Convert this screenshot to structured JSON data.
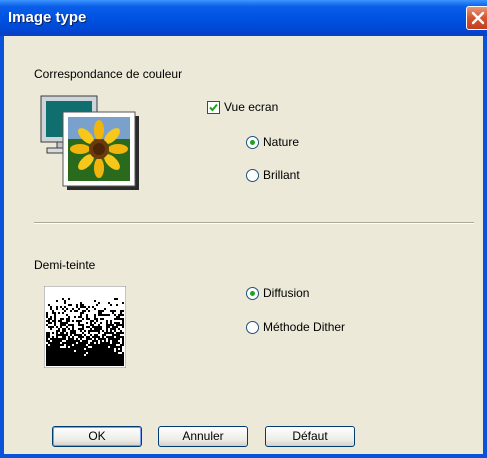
{
  "window": {
    "title": "Image type"
  },
  "color_section": {
    "label": "Correspondance de couleur",
    "checkbox_label": "Vue ecran",
    "checkbox_checked": true,
    "options": [
      {
        "label": "Nature",
        "selected": true
      },
      {
        "label": "Brillant",
        "selected": false
      }
    ]
  },
  "halftone_section": {
    "label": "Demi-teinte",
    "options": [
      {
        "label": "Diffusion",
        "selected": true
      },
      {
        "label": "Méthode Dither",
        "selected": false
      }
    ]
  },
  "buttons": {
    "ok": "OK",
    "cancel": "Annuler",
    "default": "Défaut"
  },
  "colors": {
    "title_bar": "#0054e3",
    "dialog_bg": "#ece9d8",
    "radio_dot": "#21a121",
    "close_button": "#d6532e"
  },
  "icons": {
    "close": "close-icon",
    "color_match": "monitor-sunflower-icon",
    "halftone": "dither-pattern-icon"
  }
}
